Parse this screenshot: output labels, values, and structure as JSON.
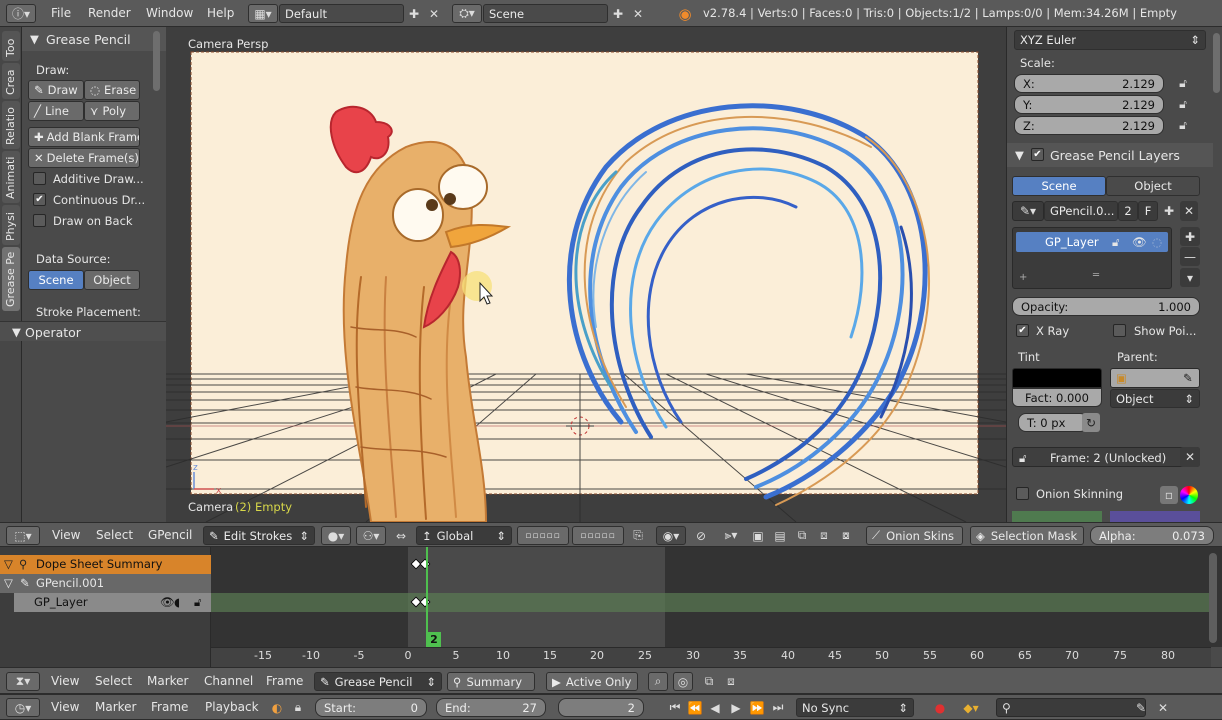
{
  "topbar": {
    "menus": [
      "File",
      "Render",
      "Window",
      "Help"
    ],
    "layout": "Default",
    "scene": "Scene",
    "stats": "v2.78.4 | Verts:0 | Faces:0 | Tris:0 | Objects:1/2 | Lamps:0/0 | Mem:34.26M | Empty"
  },
  "tool_tabs": [
    "Too",
    "Crea",
    "Relatio",
    "Animati",
    "Physi",
    "Grease Pe"
  ],
  "toolshelf": {
    "panel_title": "Grease Pencil",
    "draw_label": "Draw:",
    "draw": "Draw",
    "erase": "Erase",
    "line": "Line",
    "poly": "Poly",
    "add_blank_frame": "Add Blank Frame",
    "delete_frames": "Delete Frame(s)",
    "additive": "Additive Draw...",
    "continuous": "Continuous Dr...",
    "draw_on_back": "Draw on Back",
    "data_source": "Data Source:",
    "scene": "Scene",
    "object": "Object",
    "stroke_placement": "Stroke Placement:",
    "operator": "Operator"
  },
  "viewport": {
    "view_label": "Camera Persp",
    "footer_camera": "Camera",
    "footer_object": "(2) Empty",
    "header": {
      "menus": [
        "View",
        "Select",
        "GPencil"
      ],
      "mode": "Edit Strokes",
      "orientation": "Global",
      "onion": "Onion Skins",
      "selection_mask": "Selection Mask",
      "alpha_label": "Alpha:",
      "alpha_value": "0.073"
    }
  },
  "properties": {
    "rotation_mode": "XYZ Euler",
    "scale_label": "Scale:",
    "scale": [
      {
        "axis": "X:",
        "value": "2.129"
      },
      {
        "axis": "Y:",
        "value": "2.129"
      },
      {
        "axis": "Z:",
        "value": "2.129"
      }
    ],
    "layers_panel": "Grease Pencil Layers",
    "scene_tab": "Scene",
    "object_tab": "Object",
    "gpencil_name": "GPencil.0...",
    "users": "2",
    "fake_user": "F",
    "layer_name": "GP_Layer",
    "opacity_label": "Opacity:",
    "opacity_value": "1.000",
    "xray": "X Ray",
    "show_points": "Show Poi...",
    "tint_label": "Tint",
    "parent_label": "Parent:",
    "fact": "Fact: 0.000",
    "parent_type": "Object",
    "thickness": "T: 0 px",
    "frame_status": "Frame: 2 (Unlocked)",
    "onion_skinning": "Onion Skinning"
  },
  "dopesheet": {
    "channels": [
      {
        "name": "Dope Sheet Summary"
      },
      {
        "name": "GPencil.001"
      },
      {
        "name": "GP_Layer"
      }
    ],
    "current_frame": "2",
    "ticks": [
      "-15",
      "-10",
      "-5",
      "0",
      "5",
      "10",
      "15",
      "20",
      "25",
      "30",
      "35",
      "40",
      "45",
      "50",
      "55",
      "60",
      "65",
      "70",
      "75",
      "80"
    ],
    "header": {
      "menus": [
        "View",
        "Select",
        "Marker",
        "Channel",
        "Frame"
      ],
      "mode": "Grease Pencil",
      "summary": "Summary",
      "active_only": "Active Only"
    }
  },
  "timeline": {
    "menus": [
      "View",
      "Marker",
      "Frame",
      "Playback"
    ],
    "start_label": "Start:",
    "start_value": "0",
    "end_label": "End:",
    "end_value": "27",
    "current": "2",
    "sync": "No Sync"
  },
  "colors": {
    "accent_blue": "#5680c2",
    "playhead": "#4fc04f",
    "summary_orange": "#d8842a",
    "canvas": "#fbeed8"
  }
}
